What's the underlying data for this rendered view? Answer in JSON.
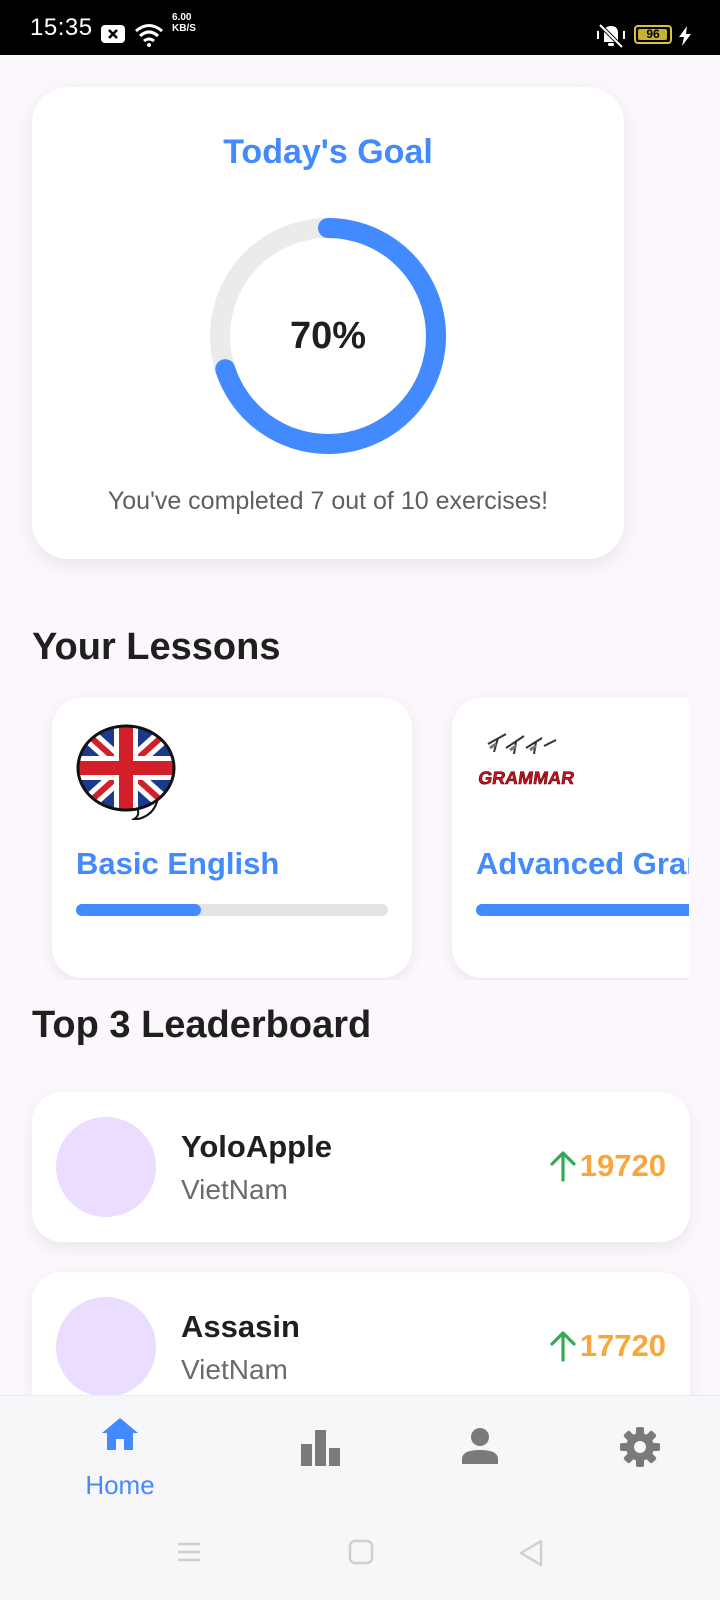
{
  "status_bar": {
    "time": "15:35",
    "speed_value": "6.00",
    "speed_unit": "KB/S",
    "battery": "96"
  },
  "goal": {
    "title": "Today's Goal",
    "percent_label": "70%",
    "progress": 0.7,
    "subtitle": "You've completed 7 out of 10 exercises!"
  },
  "lessons": {
    "title": "Your Lessons",
    "items": [
      {
        "name": "Basic English",
        "progress": 0.4,
        "icon": "uk-flag-speech-bubble-icon"
      },
      {
        "name": "Advanced Grammar",
        "progress": 1.0,
        "icon": "grammar-logo-icon",
        "logo_text": "GRAMMAR"
      }
    ]
  },
  "leaderboard": {
    "title": "Top 3 Leaderboard",
    "entries": [
      {
        "name": "YoloApple",
        "country": "VietNam",
        "score": "19720",
        "trend": "up"
      },
      {
        "name": "Assasin",
        "country": "VietNam",
        "score": "17720",
        "trend": "up"
      }
    ]
  },
  "bottom_nav": {
    "items": [
      {
        "label": "Home",
        "icon": "home-icon",
        "active": true
      },
      {
        "label": "",
        "icon": "bar-chart-icon",
        "active": false
      },
      {
        "label": "",
        "icon": "person-icon",
        "active": false
      },
      {
        "label": "",
        "icon": "gear-icon",
        "active": false
      }
    ]
  },
  "colors": {
    "accent": "#448aff",
    "score": "#f9a63a",
    "trend_up": "#34a853",
    "avatar": "#eaddff",
    "inactive_icon": "#7a7a7a"
  }
}
